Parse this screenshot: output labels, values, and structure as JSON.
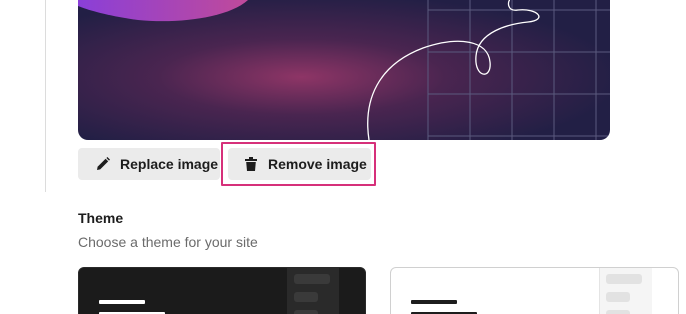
{
  "buttons": {
    "replace_label": "Replace image",
    "remove_label": "Remove image"
  },
  "theme": {
    "title": "Theme",
    "subtitle": "Choose a theme for your site"
  },
  "colors": {
    "highlight": "#d6307a",
    "button_bg": "#ebebeb",
    "banner_dark": "#221f45",
    "banner_glow": "#8e3566"
  },
  "icons": {
    "replace": "pencil-icon",
    "remove": "trash-icon"
  }
}
